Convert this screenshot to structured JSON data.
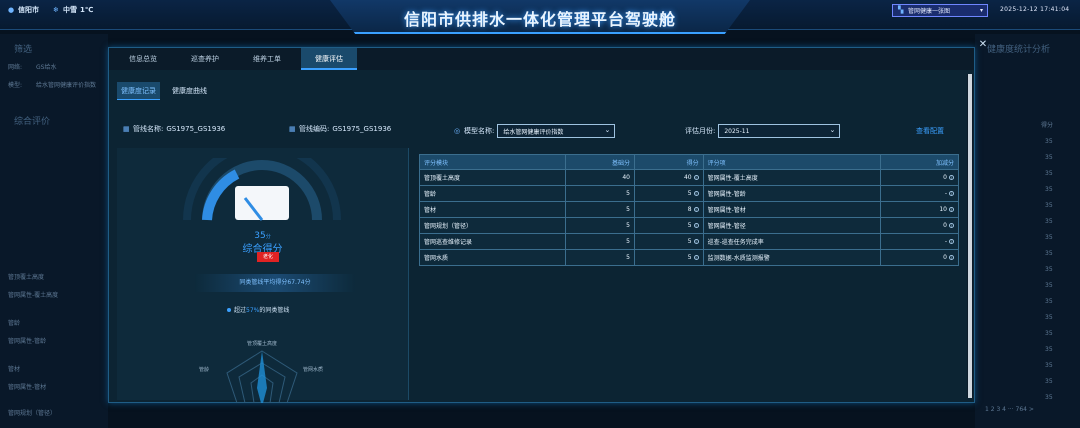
{
  "top": {
    "city": "信阳市",
    "weather": "中雪",
    "temp": "1℃",
    "title": "信阳市供排水一体化管理平台驾驶舱",
    "switch_label": "管网健康一张图",
    "datetime": "2025-12-12  17:41:04"
  },
  "tabs": [
    "信息总览",
    "巡查养护",
    "维养工单",
    "健康评估"
  ],
  "active_tab": "健康评估",
  "subtabs": [
    "健康度记录",
    "健康度曲线"
  ],
  "filters": {
    "pipe_name_label": "管线名称:",
    "pipe_name": "GS1975_GS1936",
    "pipe_code_label": "管线编码:",
    "pipe_code": "GS1975_GS1936",
    "model_label": "模型名称:",
    "model_value": "给水管网健康评价指数",
    "month_label": "评估月份:",
    "month_value": "2025-11",
    "config_link": "查看配置"
  },
  "summary": {
    "score": "35",
    "score_unit": "分",
    "score_label": "综合得分",
    "grade": "老化",
    "avg_text": "同类管线平均得分67.74分",
    "exceed_prefix": "超过",
    "exceed_pct": "57%",
    "exceed_suffix": "的同类管线",
    "radar_labels": [
      "管顶覆土高度",
      "管网水质",
      "管龄"
    ]
  },
  "table": {
    "headers": [
      "评分模块",
      "基础分",
      "得分",
      "评分项",
      "加减分"
    ],
    "rows": [
      {
        "module": "管顶覆土高度",
        "base": "40",
        "score": "40",
        "item": "管网属性-覆土高度",
        "adj": "0"
      },
      {
        "module": "管龄",
        "base": "5",
        "score": "5",
        "item": "管网属性-管龄",
        "adj": "-"
      },
      {
        "module": "管材",
        "base": "5",
        "score": "8",
        "item": "管网属性-管材",
        "adj": "10"
      },
      {
        "module": "管网规划（管径）",
        "base": "5",
        "score": "5",
        "item": "管网属性-管径",
        "adj": "0"
      },
      {
        "module": "管网巡查维修记录",
        "base": "5",
        "score": "5",
        "item": "巡查-巡查任务完成率",
        "adj": "-"
      },
      {
        "module": "管网水质",
        "base": "5",
        "score": "5",
        "item": "监测数据-水质监测报警",
        "adj": "0"
      }
    ]
  },
  "bg_left": {
    "sec1": "筛选",
    "row1": "网络:",
    "row1v": "GS给水",
    "row2": "模型:",
    "row2v": "给水管网健康评价指数",
    "sec2": "综合评价",
    "r1": "管顶覆土高度",
    "r2": "管网属性-覆土高度",
    "r3": "管龄",
    "r4": "管网属性-管龄",
    "r5": "管材",
    "r6": "管网属性-管材",
    "r7": "管网规划（管径）"
  },
  "bg_right": {
    "sec1": "健康度统计分析",
    "col": "得分",
    "vals": [
      "35",
      "35",
      "35",
      "35",
      "35",
      "35",
      "35",
      "35",
      "35",
      "35",
      "35",
      "35",
      "35",
      "35",
      "35",
      "35",
      "35"
    ],
    "pager": "1  2  3  4  ···  764  >"
  }
}
